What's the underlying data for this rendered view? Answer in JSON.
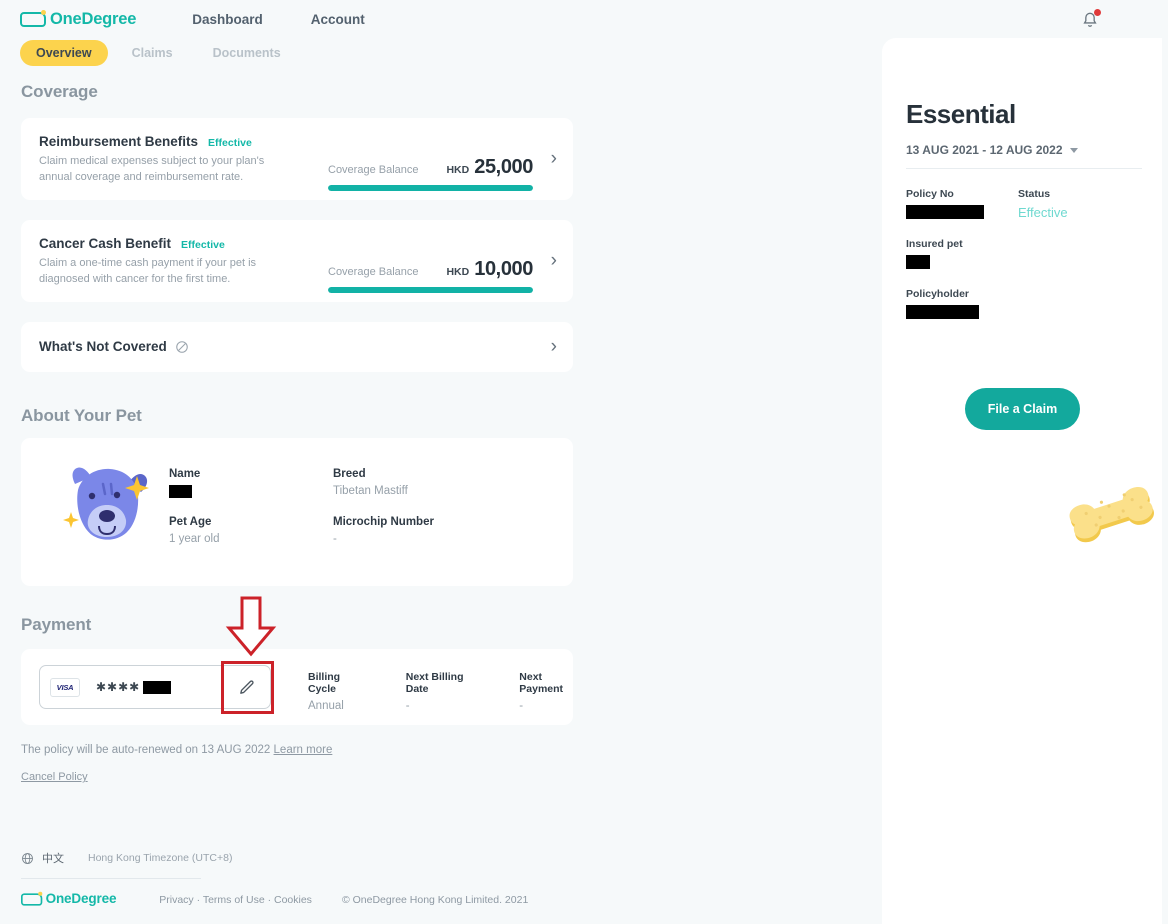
{
  "brand": {
    "name": "OneDegree",
    "teal": "#14b8a8",
    "yellow": "#fcd34d"
  },
  "header": {
    "nav": [
      {
        "label": "Dashboard"
      },
      {
        "label": "Account"
      }
    ],
    "bell_icon": "bell-icon",
    "has_notification": true
  },
  "subtabs": [
    {
      "label": "Overview",
      "active": true
    },
    {
      "label": "Claims",
      "active": false
    },
    {
      "label": "Documents",
      "active": false
    }
  ],
  "coverage": {
    "title": "Coverage",
    "benefits": [
      {
        "name": "Reimbursement Benefits",
        "status": "Effective",
        "description": "Claim medical expenses subject to your plan's annual coverage and reimbursement rate.",
        "balance_label": "Coverage Balance",
        "currency": "HKD",
        "amount": "25,000",
        "bar_percent": 100
      },
      {
        "name": "Cancer Cash Benefit",
        "status": "Effective",
        "description": "Claim a one-time cash payment if your pet is diagnosed with cancer for the first time.",
        "balance_label": "Coverage Balance",
        "currency": "HKD",
        "amount": "10,000",
        "bar_percent": 100
      }
    ],
    "not_covered": {
      "label": "What's Not Covered",
      "icon": "prohibited-icon"
    }
  },
  "pet": {
    "title": "About Your Pet",
    "avatar_icon": "dog-avatar-icon",
    "fields": [
      {
        "label": "Name",
        "value": "",
        "redacted": true,
        "redact_width": 23
      },
      {
        "label": "Breed",
        "value": "Tibetan Mastiff",
        "redacted": false
      },
      {
        "label": "Pet Age",
        "value": "1 year old",
        "redacted": false
      },
      {
        "label": "Microchip Number",
        "value": "-",
        "redacted": false
      }
    ]
  },
  "payment": {
    "title": "Payment",
    "card": {
      "brand_logo": "VISA",
      "mask_stars": "✱✱✱✱",
      "masked_digits_redacted": true,
      "edit_icon": "pencil-edit-icon"
    },
    "meta": [
      {
        "label": "Billing Cycle",
        "value": "Annual"
      },
      {
        "label": "Next Billing Date",
        "value": "-"
      },
      {
        "label": "Next Payment",
        "value": "-"
      }
    ]
  },
  "notes": {
    "renew_text": "The policy will be auto-renewed on 13 AUG 2022",
    "learn_more": "Learn more",
    "cancel_policy": "Cancel Policy"
  },
  "footer": {
    "globe_icon": "globe-icon",
    "language": "中文",
    "timezone": "Hong Kong Timezone (UTC+8)",
    "links": "Privacy · Terms of Use · Cookies",
    "copyright": "© OneDegree Hong Kong Limited. 2021"
  },
  "policy_panel": {
    "plan_name": "Essential",
    "date_range": "13 AUG 2021 - 12 AUG 2022",
    "fields": [
      {
        "label": "Policy No",
        "value": "",
        "redacted": true,
        "redact_width": 78
      },
      {
        "label": "Status",
        "value": "Effective",
        "redacted": false
      },
      {
        "label": "Insured pet",
        "value": "",
        "redacted": true,
        "redact_width": 24
      },
      {
        "label": "Policyholder",
        "value": "",
        "redacted": true,
        "redact_width": 73
      }
    ],
    "file_claim_label": "File a Claim",
    "bone_icon": "dog-bone-icon"
  },
  "annotation": {
    "color": "#cc2229",
    "target": "pencil-edit-icon",
    "shape": "down-arrow-with-box"
  }
}
